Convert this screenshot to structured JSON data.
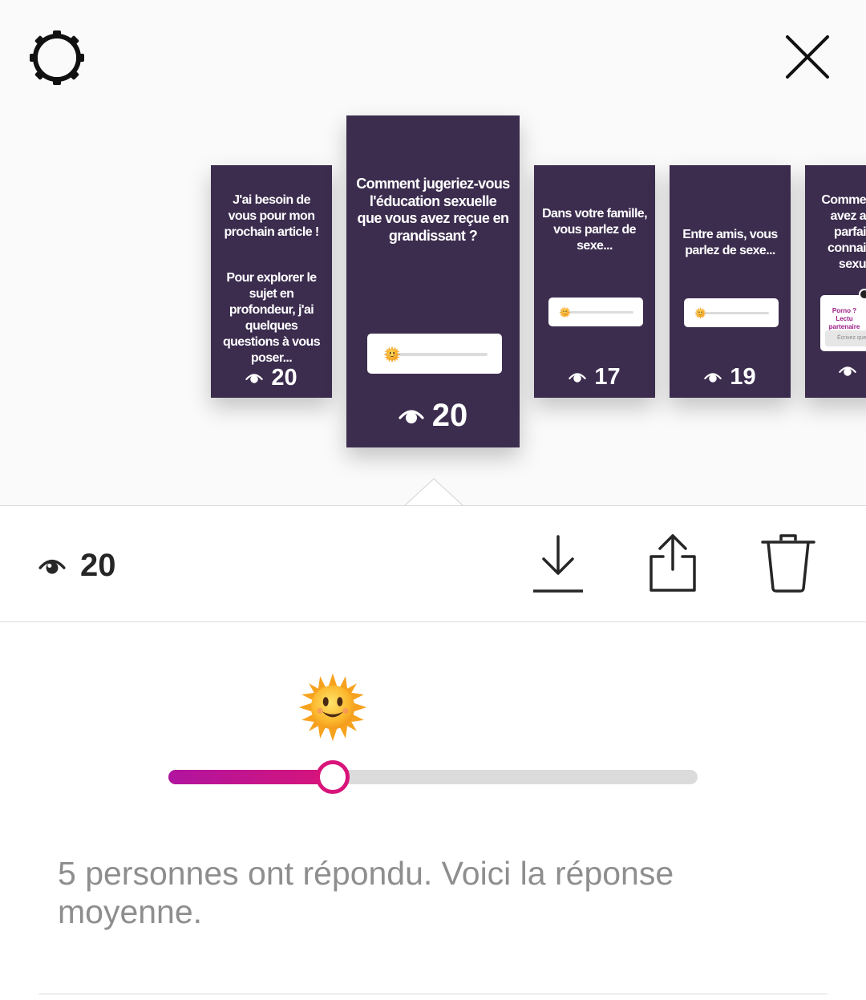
{
  "header": {
    "settings_icon": "gear-icon",
    "close_icon": "close-icon"
  },
  "stories": [
    {
      "text1": "J'ai besoin de vous pour mon prochain article !",
      "text2": "Pour explorer le sujet en profondeur, j'ai quelques questions à vous poser...",
      "views": "20"
    },
    {
      "text": "Comment jugeriez-vous l'éducation sexuelle que vous avez reçue en grandissant ?",
      "views": "20",
      "slider_level": 0.04
    },
    {
      "text": "Dans votre famille, vous parlez de sexe...",
      "views": "17",
      "slider_level": 0.04
    },
    {
      "text": "Entre amis, vous parlez de sexe...",
      "views": "19",
      "slider_level": 0.04
    },
    {
      "text": "Comme avez a parfai connai sexu",
      "question_title": "Porno ? Lectu partenaire",
      "question_placeholder": "Écrivez que",
      "views": ""
    }
  ],
  "action_bar": {
    "views": "20",
    "icons": [
      "eye-icon",
      "download-icon",
      "share-icon",
      "trash-icon"
    ]
  },
  "result": {
    "emoji": "sun-with-face",
    "average": 0.31,
    "text": "5 personnes ont répondu. Voici la réponse moyenne."
  },
  "colors": {
    "story_bg": "#3c2d4f",
    "slider_start": "#b0149f",
    "slider_end": "#d8147a",
    "muted_text": "#8e8e8e"
  }
}
